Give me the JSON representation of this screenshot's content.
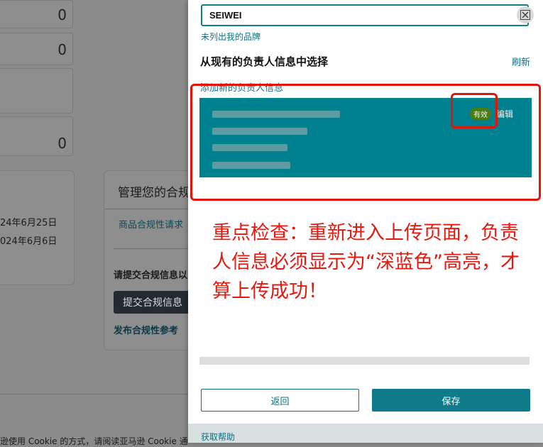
{
  "background": {
    "counts": [
      "0",
      "0",
      "0"
    ],
    "dates": [
      "24年6月25日",
      "024年6月6日"
    ],
    "card_title": "管理您的合规",
    "request_link": "商品合规性请求",
    "submit_prompt": "请提交合规信息以",
    "submit_button": "提交合规信息",
    "reference_link": "发布合规性参考",
    "cookie_text": "逊使用 Cookie 的方式，请阅读亚马逊 Cookie 通"
  },
  "drawer": {
    "brand_value": "SEIWEI",
    "brand_unlisted_link": "未列出我的品牌",
    "section_title": "从现有的负责人信息中选择",
    "refresh_label": "刷新",
    "add_new_link": "添加新的负责人信息",
    "status_badge": "有效",
    "edit_label": "编辑",
    "back_button": "返回",
    "save_button": "保存",
    "help_link": "获取帮助"
  },
  "annotation": {
    "note": "重点检查：重新进入上传页面，负责人信息必须显示为“深蓝色”高亮，才算上传成功！",
    "color": "#e5190f"
  },
  "colors": {
    "accent": "#0f7b8a",
    "card_selected": "#008190",
    "badge": "#4c7a16"
  }
}
